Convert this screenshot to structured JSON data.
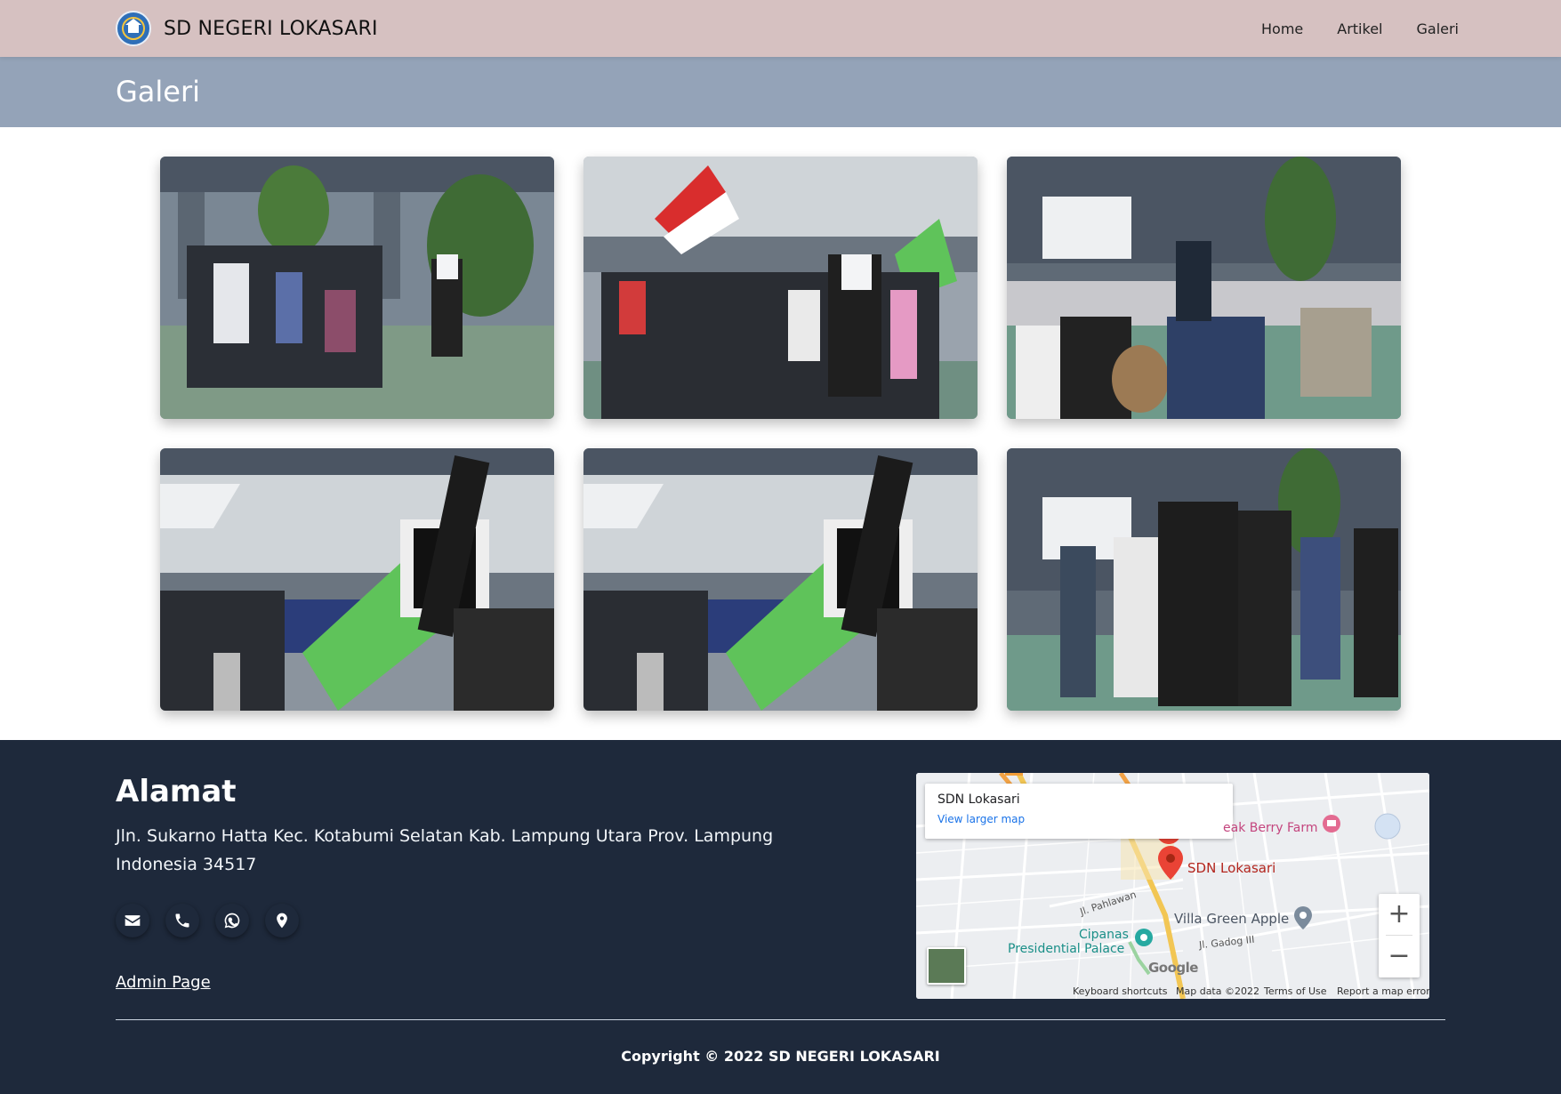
{
  "navbar": {
    "brand_name": "SD NEGERI LOKASARI",
    "links": [
      "Home",
      "Artikel",
      "Galeri"
    ]
  },
  "page": {
    "title": "Galeri"
  },
  "gallery": {
    "photo_count": 6
  },
  "footer": {
    "title": "Alamat",
    "address": "Jln. Sukarno Hatta Kec. Kotabumi Selatan Kab. Lampung Utara Prov. Lampung Indonesia 34517",
    "icons": [
      "envelope-icon",
      "phone-icon",
      "whatsapp-icon",
      "location-pin-icon"
    ],
    "admin_link": "Admin Page",
    "copyright": "Copyright © 2022 SD NEGERI LOKASARI"
  },
  "map": {
    "card_title": "SDN Lokasari",
    "card_link": "View larger map",
    "labels": {
      "place_main": "SDN Lokasari",
      "berry": "eak Berry Farm",
      "villa": "Villa Green Apple",
      "palace_1": "Cipanas",
      "palace_2": "Presidential Palace",
      "street_1": "Jl. Pahlawan",
      "street_2": "Jl. Gadog III",
      "google": "Google"
    },
    "zoom_in": "+",
    "zoom_out": "−",
    "attribution": {
      "shortcuts": "Keyboard shortcuts",
      "data": "Map data ©2022",
      "terms": "Terms of Use",
      "report": "Report a map error"
    }
  },
  "colors": {
    "navbar_bg": "#d6c1c1",
    "header_bg": "#94a3b8",
    "footer_bg": "#1e293b",
    "pin": "#ea4335"
  }
}
